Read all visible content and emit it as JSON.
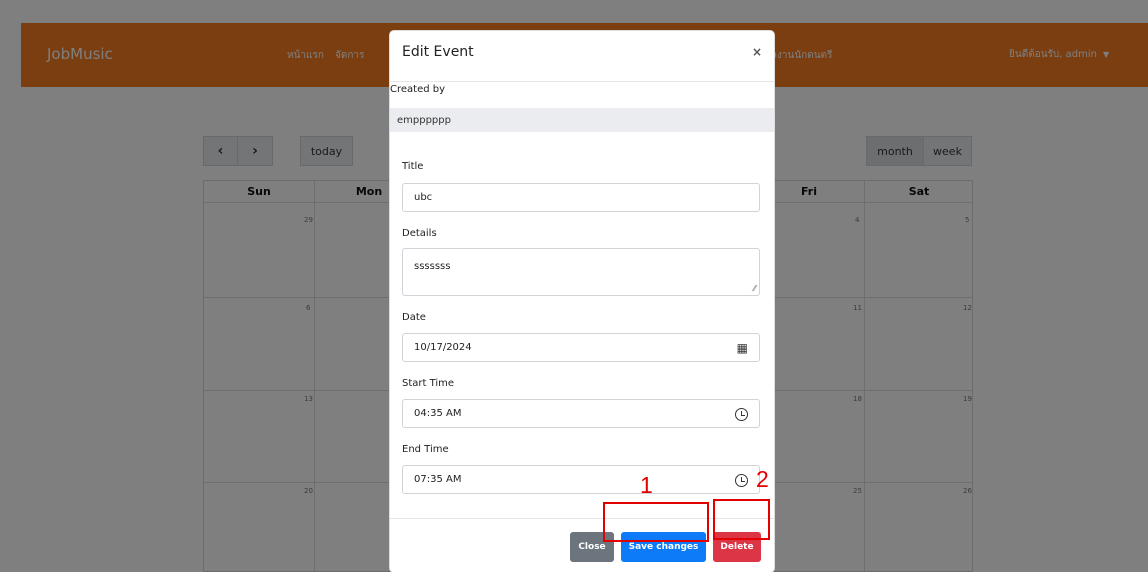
{
  "background": {
    "brand": "JobMusic",
    "nav_links": [
      "หน้าแรก",
      "จัดการ",
      "ผลงานนักดนตรี"
    ],
    "user_menu": "ยินดีต้อนรับ, admin",
    "calendar": {
      "today": "today",
      "month": "month",
      "week": "week",
      "day_headers": [
        "Sun",
        "Mon",
        "Fri",
        "Sat"
      ],
      "dates": [
        "29",
        "4",
        "5",
        "6",
        "11",
        "12",
        "13",
        "18",
        "19",
        "20",
        "25",
        "26"
      ]
    }
  },
  "modal": {
    "title": "Edit Event",
    "created_by_label": "Created by",
    "created_by_value": "empppppp",
    "title_label": "Title",
    "title_value": "ubc",
    "details_label": "Details",
    "details_value": "sssssss",
    "date_label": "Date",
    "date_value": "10/17/2024",
    "start_time_label": "Start Time",
    "start_time_value": "04:35 AM",
    "end_time_label": "End Time",
    "end_time_value": "07:35 AM",
    "close_label": "Close",
    "save_label": "Save changes",
    "delete_label": "Delete"
  },
  "annotations": {
    "one": "1",
    "two": "2"
  },
  "colors": {
    "navbar": "#f47c20",
    "save": "#0d7bf7",
    "delete": "#dc3545",
    "close": "#6c757d",
    "annotation": "#e30000"
  }
}
